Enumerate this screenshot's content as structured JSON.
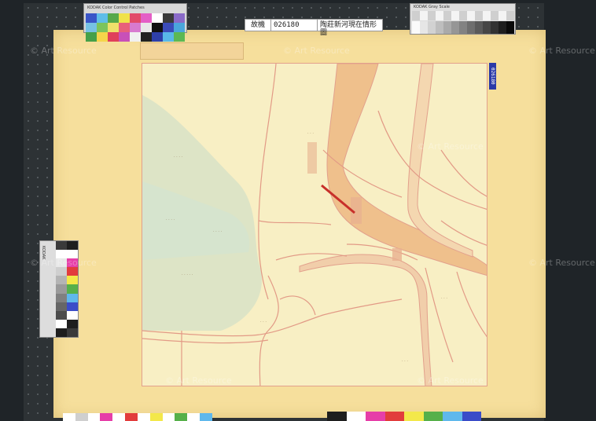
{
  "label": {
    "collection": "故機",
    "number": "026180",
    "title": "陶莊新河現在情形圖"
  },
  "side_tag": "026180",
  "colorbar": {
    "title": "KODAK Color Control Patches",
    "swatches": [
      "#3a55c8",
      "#5fbde8",
      "#56a84a",
      "#f0e24a",
      "#e24a6a",
      "#e45ec6",
      "#ffffff",
      "#3a3a3a",
      "#8a6ac8",
      "#76c2e4",
      "#7cc45c",
      "#efe06a",
      "#e8607a",
      "#d87ad0",
      "#e8e8e8",
      "#111111",
      "#3b4bb8",
      "#4aa6dc",
      "#45a049",
      "#f5d54a",
      "#e0405a",
      "#c850b8",
      "#f0f0f0",
      "#222222",
      "#2e3fa8",
      "#58b8e8",
      "#5cb854",
      "#f2dc60",
      "#dc3c58",
      "#cf58c0",
      "#fafafa",
      "#0c0c0c",
      "#5060c0"
    ]
  },
  "graybar": {
    "title": "KODAK Gray Scale",
    "levels": [
      "#fafafa",
      "#e6e6e6",
      "#d2d2d2",
      "#bebebe",
      "#aaaaaa",
      "#969696",
      "#828282",
      "#6e6e6e",
      "#5a5a5a",
      "#464646",
      "#323232",
      "#1e1e1e",
      "#0a0a0a"
    ]
  },
  "left_bar": {
    "title": "KODAK",
    "col1": [
      "#3a3a3a",
      "#ffffff",
      "#e8e8e8",
      "#cfcfcf",
      "#b4b4b4",
      "#9a9a9a",
      "#808080",
      "#666666",
      "#4c4c4c",
      "#ffffff",
      "#1e1e1e"
    ],
    "col2": [
      "#1e1e1e",
      "#ffffff",
      "#e63ea8",
      "#e23c3c",
      "#f3e84a",
      "#56b04a",
      "#5fb8ec",
      "#3a4cc8",
      "#ffffff",
      "#1e1e1e",
      "#3a3a3a"
    ]
  },
  "bottom_bars": {
    "left": [
      "#ffffff",
      "#cfcfcf",
      "#ffffff",
      "#e63ea8",
      "#ffffff",
      "#e23c3c",
      "#ffffff",
      "#f3e84a",
      "#ffffff",
      "#56b04a",
      "#ffffff",
      "#5fb8ec"
    ],
    "right": [
      "#1e1e1e",
      "#ffffff",
      "#e63ea8",
      "#e23c3c",
      "#f3e84a",
      "#56b04a",
      "#5fb8ec",
      "#3a4cc8"
    ]
  },
  "watermarks": [
    "© Art Resource",
    "© Art Resource",
    "© Art Resource",
    "© Art Resource",
    "© Art Resource",
    "© Art Resource",
    "© Art Resource",
    "© Art Resource"
  ],
  "map_colors": {
    "river": "#efc08c",
    "river_edge": "#e2a08c",
    "road": "#e29a86",
    "marsh": "#b7d7c9",
    "red_text": "#c8302a",
    "ink": "#8a6a4a"
  }
}
